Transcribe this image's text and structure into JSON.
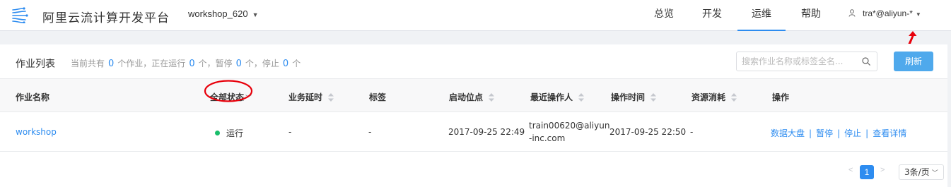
{
  "header": {
    "app_title": "阿里云流计算开发平台",
    "project": "workshop_620",
    "nav": [
      "总览",
      "开发",
      "运维",
      "帮助"
    ],
    "active_nav": "运维",
    "user": "tra*@aliyun-*"
  },
  "job_list": {
    "title": "作业列表",
    "summary": {
      "prefix": "当前共有",
      "total": "0",
      "text_jobs_running": "个作业，正在运行",
      "running": "0",
      "text_paused": "个，暂停",
      "paused": "0",
      "text_stopped": "个，停止",
      "stopped": "0",
      "suffix": "个"
    },
    "search_placeholder": "搜索作业名称或标签全名...",
    "refresh_label": "刷新",
    "columns": [
      "作业名称",
      "全部状态",
      "业务延时",
      "标签",
      "启动位点",
      "最近操作人",
      "操作时间",
      "资源消耗",
      "操作"
    ],
    "rows": [
      {
        "name": "workshop",
        "status": "运行",
        "delay": "-",
        "tag": "-",
        "start_offset": "2017-09-25 22:49",
        "operator_line1": "train00620@aliyun",
        "operator_line2": "-inc.com",
        "op_time": "2017-09-25 22:50",
        "resource": "-",
        "actions": [
          "数据大盘",
          "暂停",
          "停止",
          "查看详情"
        ]
      }
    ]
  },
  "pagination": {
    "prev": "<",
    "current": "1",
    "next": ">",
    "page_size": "3条/页"
  },
  "colors": {
    "accent": "#2d8cf0",
    "refresh_button": "#4fa9ec",
    "running_dot": "#19be6b",
    "annotation_red": "#e8000b"
  },
  "icons": [
    "logo-icon",
    "user-icon",
    "search-icon",
    "sort-icon",
    "chevron-down-icon"
  ]
}
